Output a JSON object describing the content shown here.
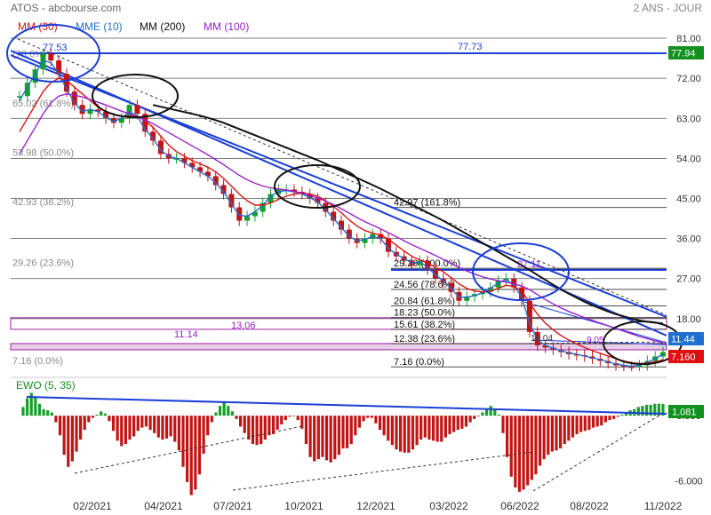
{
  "header": {
    "title": "ATOS - abcbourse.com",
    "period": "2 ANS - JOUR",
    "legend": [
      {
        "label": "MM (30)",
        "color": "#e01010"
      },
      {
        "label": "MME (10)",
        "color": "#1f6fd1"
      },
      {
        "label": "MM (200)",
        "color": "#111111"
      },
      {
        "label": "MM (100)",
        "color": "#9a1fd1"
      }
    ]
  },
  "chart_data": [
    {
      "type": "line",
      "panel": "price",
      "ylim": [
        6.2,
        82
      ],
      "y_ticks": [
        "81.00",
        "72.00",
        "63.00",
        "54.00",
        "45.00",
        "36.00",
        "27.00",
        "18.00"
      ],
      "x_ticks": [
        "02/2021",
        "04/2021",
        "07/2021",
        "10/2021",
        "12/2021",
        "03/2022",
        "06/2022",
        "08/2022",
        "11/2022"
      ],
      "candles_close": [
        68,
        71,
        74,
        77.5,
        76,
        73,
        69,
        66,
        64,
        65,
        64.5,
        63,
        62,
        63,
        66,
        64,
        60,
        58,
        55,
        54,
        54,
        53,
        52,
        51,
        50,
        48,
        46,
        43,
        40,
        41,
        42,
        44,
        46,
        47,
        47,
        46.5,
        46,
        45,
        44,
        42,
        40,
        38,
        36,
        35,
        36,
        37,
        36,
        33,
        32,
        31,
        30,
        31,
        29,
        27,
        26,
        24,
        22,
        23,
        23.5,
        24,
        25,
        26.5,
        27,
        25,
        22,
        15,
        12,
        11.5,
        11,
        10.5,
        10,
        9.8,
        9.5,
        9,
        8.5,
        8,
        7.5,
        7.2,
        7.16,
        7.5,
        8.5,
        9.5,
        10.5
      ],
      "series": [
        {
          "name": "MME (10)",
          "color": "#1f6fd1",
          "values": [
            67,
            70,
            73,
            76,
            75.5,
            73,
            69.5,
            66.5,
            64.5,
            65,
            64.5,
            63.2,
            62.3,
            63,
            64.5,
            63.5,
            60.5,
            58.5,
            55.8,
            54.5,
            54,
            53,
            52,
            51,
            50,
            48.5,
            46.5,
            43.8,
            41.2,
            41,
            42,
            43.5,
            45.5,
            46.5,
            46.8,
            46.5,
            46,
            45.2,
            44.2,
            42.5,
            40.5,
            38.5,
            36.5,
            35.5,
            35.8,
            36.5,
            36,
            33.8,
            32.5,
            31.5,
            30.5,
            30.8,
            29.5,
            27.8,
            26.5,
            24.8,
            22.8,
            22.8,
            23.2,
            23.8,
            24.8,
            26,
            26.8,
            25.5,
            22.8,
            17,
            13.2,
            12,
            11.3,
            10.8,
            10.3,
            10,
            9.6,
            9.2,
            8.8,
            8.3,
            7.8,
            7.5,
            7.3,
            7.5,
            8.2,
            9,
            10
          ]
        },
        {
          "name": "MM (30)",
          "color": "#e01010",
          "values": [
            60,
            63,
            66,
            69,
            71,
            72,
            71.5,
            70,
            68.5,
            67,
            65.5,
            64.5,
            63.8,
            63.5,
            63.5,
            63.5,
            62.5,
            61,
            59,
            57,
            55.5,
            54.5,
            53.5,
            52.8,
            52,
            51,
            49.5,
            47.8,
            46,
            44.5,
            43.5,
            43.5,
            44,
            44.8,
            45.5,
            46,
            46.2,
            46,
            45.5,
            44.5,
            43.2,
            41.8,
            40.2,
            38.8,
            37.8,
            37.2,
            36.8,
            35.8,
            34.5,
            33.2,
            32,
            31.2,
            30.5,
            29.5,
            28.5,
            27.2,
            25.8,
            24.8,
            24.2,
            24,
            24.2,
            24.8,
            25.5,
            25.2,
            24.2,
            21.5,
            19,
            17,
            15.5,
            14.2,
            13.2,
            12.3,
            11.5,
            10.8,
            10.2,
            9.6,
            9,
            8.5,
            8.1,
            7.9,
            8,
            8.3,
            8.8
          ]
        },
        {
          "name": "MM (100)",
          "color": "#9a1fd1",
          "values": [
            55,
            58,
            61,
            64,
            66.5,
            68,
            68.5,
            68.2,
            67.8,
            67.2,
            66.6,
            66,
            65.3,
            64.6,
            64,
            63.3,
            62.6,
            61.8,
            60.8,
            59.8,
            58.8,
            57.8,
            56.8,
            55.8,
            54.8,
            53.7,
            52.6,
            51.4,
            50.2,
            49.2,
            48.4,
            47.8,
            47.4,
            47.1,
            46.9,
            46.6,
            46.2,
            45.7,
            45.1,
            44.4,
            43.6,
            42.7,
            41.7,
            40.7,
            39.8,
            39,
            38.2,
            37.3,
            36.4,
            35.5,
            34.6,
            33.8,
            33,
            32.2,
            31.3,
            30.4,
            29.5,
            28.7,
            28,
            27.4,
            26.9,
            26.5,
            26.2,
            25.8,
            25.3,
            24.5,
            23.4,
            22.3,
            21.3,
            20.4,
            19.6,
            18.9,
            18.2,
            17.6,
            17,
            16.4,
            15.8,
            15.2,
            14.6,
            14,
            13.5,
            13,
            12.6
          ]
        },
        {
          "name": "MM (200)",
          "color": "#111111",
          "values": [
            null,
            null,
            null,
            null,
            null,
            null,
            null,
            null,
            null,
            null,
            null,
            null,
            null,
            null,
            null,
            null,
            null,
            66,
            65.6,
            65.2,
            64.8,
            64.4,
            64,
            63.6,
            63.1,
            62.6,
            62,
            61.3,
            60.6,
            59.9,
            59.2,
            58.5,
            57.8,
            57.1,
            56.4,
            55.7,
            55,
            54.3,
            53.6,
            52.8,
            52,
            51.2,
            50.4,
            49.6,
            48.8,
            48,
            47.2,
            46.3,
            45.4,
            44.5,
            43.6,
            42.7,
            41.8,
            40.9,
            40,
            39,
            38,
            37,
            36,
            35,
            34,
            33,
            32,
            31,
            30,
            28.9,
            27.8,
            26.7,
            25.6,
            24.6,
            23.6,
            22.7,
            21.8,
            21,
            20.3,
            19.6,
            19,
            18.5,
            18,
            17.6,
            17.3,
            17.1,
            16.9
          ]
        }
      ],
      "fibonacci_left": [
        {
          "label": "(78.6%)",
          "value": 76.1
        },
        {
          "label": "65.02  (61.8%)",
          "value": 65.02
        },
        {
          "label": "53.98  (50.0%)",
          "value": 53.98
        },
        {
          "label": "42.93  (38.2%)",
          "value": 42.93
        },
        {
          "label": "29.26  (23.6%)",
          "value": 29.26
        },
        {
          "label": "7.16  (0.0%)",
          "value": 7.16
        }
      ],
      "fibonacci_right": [
        {
          "label": "42.97  (161.8%)",
          "value": 42.97
        },
        {
          "label": "29.29  (100.0%)",
          "value": 29.29
        },
        {
          "label": "24.56  (78.6%)",
          "value": 24.56
        },
        {
          "label": "20.84  (61.8%)",
          "value": 20.84
        },
        {
          "label": "18.23  (50.0%)",
          "value": 18.23
        },
        {
          "label": "15.61  (38.2%)",
          "value": 15.61
        },
        {
          "label": "12.38  (23.6%)",
          "value": 12.38
        },
        {
          "label": "7.16  (0.0%)",
          "value": 7.16
        }
      ],
      "annotations": [
        {
          "label": "77.53",
          "value": 77.53
        },
        {
          "label": "77.73",
          "value": 77.73
        },
        {
          "label": "27.11",
          "value": 27.11
        },
        {
          "label": "13.06",
          "value": 13.06
        },
        {
          "label": "11.14",
          "value": 11.14
        },
        {
          "label": "10.04",
          "value": 10.04
        },
        {
          "label": "9.05",
          "value": 9.05
        }
      ],
      "last_price_badges": [
        {
          "label": "77.94",
          "color": "#12911f"
        },
        {
          "label": "11.44",
          "color": "#1f6fd1"
        },
        {
          "label": "7.160",
          "color": "#e01010"
        }
      ]
    },
    {
      "type": "bar",
      "panel": "oscillator",
      "title": "EWO (5, 35)",
      "ylim": [
        -7.5,
        2.3
      ],
      "y_ticks": [
        "0.000",
        "-6.000"
      ],
      "badge": "1.081",
      "values": [
        0.8,
        1.6,
        2.1,
        1.7,
        1.1,
        0.6,
        0.5,
        0.3,
        -0.6,
        -1.8,
        -3.6,
        -4.7,
        -4.2,
        -3.3,
        -2.2,
        -1.3,
        -0.6,
        -0.2,
        0.1,
        0.4,
        0.2,
        -0.5,
        -1.4,
        -2.3,
        -2.8,
        -2.6,
        -2.2,
        -1.9,
        -1.4,
        -1.1,
        -1.0,
        -1.3,
        -1.6,
        -2.0,
        -2.2,
        -2.1,
        -1.9,
        -2.4,
        -3.2,
        -4.7,
        -6.1,
        -7.3,
        -6.8,
        -5.4,
        -3.5,
        -1.8,
        -0.6,
        0.3,
        0.9,
        1.2,
        0.9,
        0.4,
        -0.3,
        -1.0,
        -1.6,
        -2.2,
        -2.6,
        -2.7,
        -2.6,
        -2.2,
        -1.8,
        -1.7,
        -1.3,
        -0.8,
        -0.4,
        -0.1,
        0.0,
        -0.4,
        -1.2,
        -2.6,
        -3.8,
        -4.2,
        -4.0,
        -3.8,
        -4.1,
        -4.3,
        -4.0,
        -3.6,
        -3.0,
        -3.0,
        -2.6,
        -1.8,
        -1.1,
        -0.5,
        -0.2,
        -0.2,
        -0.7,
        -1.3,
        -1.8,
        -2.3,
        -2.7,
        -3.1,
        -3.3,
        -3.4,
        -3.4,
        -3.1,
        -2.7,
        -2.2,
        -2.0,
        -2.2,
        -2.3,
        -2.4,
        -2.4,
        -2.0,
        -1.7,
        -1.5,
        -1.3,
        -1.2,
        -1.0,
        -0.6,
        -0.3,
        0.0,
        0.3,
        0.6,
        0.9,
        0.6,
        0.1,
        -1.6,
        -3.8,
        -5.6,
        -6.6,
        -7.0,
        -6.8,
        -6.4,
        -5.9,
        -5.4,
        -4.6,
        -4.0,
        -3.6,
        -3.3,
        -3.2,
        -3.0,
        -2.6,
        -2.3,
        -2.0,
        -1.7,
        -1.5,
        -1.4,
        -1.3,
        -1.1,
        -1.0,
        -0.9,
        -0.6,
        -0.4,
        -0.3,
        -0.1,
        0.1,
        0.3,
        0.5,
        0.6,
        0.8,
        0.9,
        1.0,
        1.0,
        1.1,
        1.1,
        1.08
      ]
    }
  ]
}
